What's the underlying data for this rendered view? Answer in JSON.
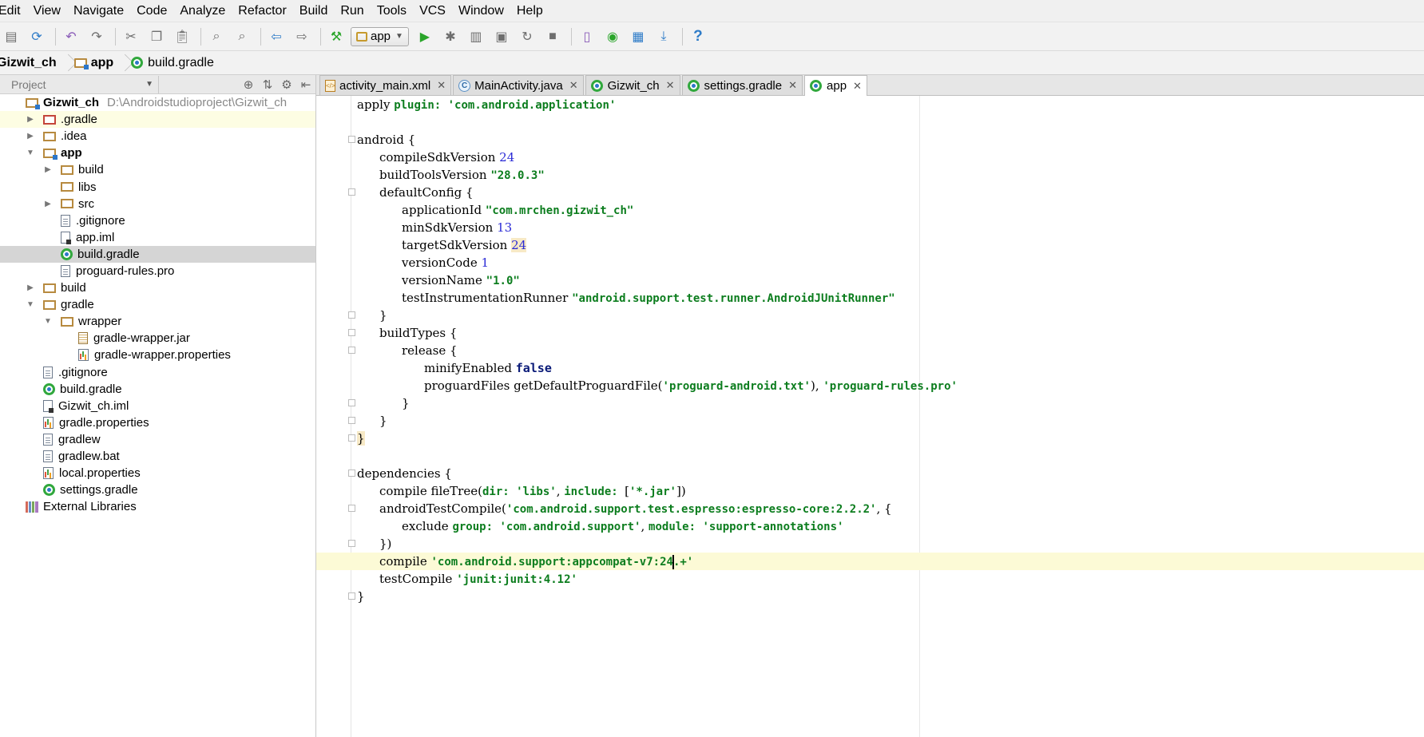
{
  "menubar": {
    "items": [
      "Edit",
      "View",
      "Navigate",
      "Code",
      "Analyze",
      "Refactor",
      "Build",
      "Run",
      "Tools",
      "VCS",
      "Window",
      "Help"
    ]
  },
  "toolbar": {
    "run_config": "app",
    "icons": [
      "save-all-icon",
      "sync-icon",
      "undo-icon",
      "redo-icon",
      "cut-icon",
      "copy-icon",
      "paste-icon",
      "find-icon",
      "replace-icon",
      "back-icon",
      "forward-icon",
      "make-project-icon",
      "run-icon",
      "debug-icon",
      "coverage-icon",
      "attach-debugger-icon",
      "apply-changes-icon",
      "stop-icon",
      "avd-manager-icon",
      "sync-gradle-icon",
      "project-structure-icon",
      "sdk-manager-icon",
      "help-icon"
    ]
  },
  "breadcrumb": {
    "items": [
      "Gizwit_ch",
      "app",
      "build.gradle"
    ]
  },
  "project_panel": {
    "view_label": "Project",
    "tree": [
      {
        "label": "Gizwit_ch",
        "path": "D:\\Androidstudioproject\\Gizwit_ch",
        "depth": 0,
        "icon": "module-folder-icon",
        "arrow": "",
        "bold": true
      },
      {
        "label": ".gradle",
        "depth": 1,
        "icon": "excluded-folder-icon",
        "arrow": "▶",
        "highlight": true
      },
      {
        "label": ".idea",
        "depth": 1,
        "icon": "folder-icon",
        "arrow": "▶"
      },
      {
        "label": "app",
        "depth": 1,
        "icon": "module-folder-icon",
        "arrow": "▼",
        "bold": true
      },
      {
        "label": "build",
        "depth": 2,
        "icon": "folder-icon",
        "arrow": "▶"
      },
      {
        "label": "libs",
        "depth": 2,
        "icon": "folder-icon",
        "arrow": ""
      },
      {
        "label": "src",
        "depth": 2,
        "icon": "folder-icon",
        "arrow": "▶"
      },
      {
        "label": ".gitignore",
        "depth": 2,
        "icon": "file-icon",
        "arrow": ""
      },
      {
        "label": "app.iml",
        "depth": 2,
        "icon": "iml-file-icon",
        "arrow": ""
      },
      {
        "label": "build.gradle",
        "depth": 2,
        "icon": "gradle-icon",
        "arrow": "",
        "selected": true
      },
      {
        "label": "proguard-rules.pro",
        "depth": 2,
        "icon": "file-icon",
        "arrow": ""
      },
      {
        "label": "build",
        "depth": 1,
        "icon": "folder-icon",
        "arrow": "▶"
      },
      {
        "label": "gradle",
        "depth": 1,
        "icon": "folder-icon",
        "arrow": "▼"
      },
      {
        "label": "wrapper",
        "depth": 2,
        "icon": "folder-icon",
        "arrow": "▼"
      },
      {
        "label": "gradle-wrapper.jar",
        "depth": 3,
        "icon": "jar-icon",
        "arrow": ""
      },
      {
        "label": "gradle-wrapper.properties",
        "depth": 3,
        "icon": "properties-icon",
        "arrow": ""
      },
      {
        "label": ".gitignore",
        "depth": 1,
        "icon": "file-icon",
        "arrow": ""
      },
      {
        "label": "build.gradle",
        "depth": 1,
        "icon": "gradle-icon",
        "arrow": ""
      },
      {
        "label": "Gizwit_ch.iml",
        "depth": 1,
        "icon": "iml-file-icon",
        "arrow": ""
      },
      {
        "label": "gradle.properties",
        "depth": 1,
        "icon": "properties-icon",
        "arrow": ""
      },
      {
        "label": "gradlew",
        "depth": 1,
        "icon": "file-icon",
        "arrow": ""
      },
      {
        "label": "gradlew.bat",
        "depth": 1,
        "icon": "file-icon",
        "arrow": ""
      },
      {
        "label": "local.properties",
        "depth": 1,
        "icon": "properties-icon",
        "arrow": ""
      },
      {
        "label": "settings.gradle",
        "depth": 1,
        "icon": "gradle-icon",
        "arrow": ""
      },
      {
        "label": "External Libraries",
        "depth": 0,
        "icon": "libraries-icon",
        "arrow": ""
      }
    ]
  },
  "tabs": [
    {
      "label": "activity_main.xml",
      "icon": "xml-icon",
      "active": false
    },
    {
      "label": "MainActivity.java",
      "icon": "class-icon",
      "active": false
    },
    {
      "label": "Gizwit_ch",
      "icon": "gradle-icon",
      "active": false
    },
    {
      "label": "settings.gradle",
      "icon": "gradle-icon",
      "active": false
    },
    {
      "label": "app",
      "icon": "gradle-icon",
      "active": true
    }
  ],
  "editor": {
    "lines": [
      {
        "indent": 0,
        "tokens": [
          [
            "t",
            "apply "
          ],
          [
            "named",
            "plugin: "
          ],
          [
            "str",
            "'com.android.application'"
          ]
        ]
      },
      {
        "indent": 0,
        "tokens": []
      },
      {
        "indent": 0,
        "fold": true,
        "tokens": [
          [
            "t",
            "android {"
          ]
        ]
      },
      {
        "indent": 1,
        "tokens": [
          [
            "t",
            "compileSdkVersion "
          ],
          [
            "num",
            "24"
          ]
        ]
      },
      {
        "indent": 1,
        "tokens": [
          [
            "t",
            "buildToolsVersion "
          ],
          [
            "str",
            "\"28.0.3\""
          ]
        ]
      },
      {
        "indent": 1,
        "fold": true,
        "tokens": [
          [
            "t",
            "defaultConfig {"
          ]
        ]
      },
      {
        "indent": 2,
        "tokens": [
          [
            "t",
            "applicationId "
          ],
          [
            "str",
            "\"com.mrchen.gizwit_ch\""
          ]
        ]
      },
      {
        "indent": 2,
        "tokens": [
          [
            "t",
            "minSdkVersion "
          ],
          [
            "num",
            "13"
          ]
        ]
      },
      {
        "indent": 2,
        "tokens": [
          [
            "t",
            "targetSdkVersion "
          ],
          [
            "numhl",
            "24"
          ]
        ]
      },
      {
        "indent": 2,
        "tokens": [
          [
            "t",
            "versionCode "
          ],
          [
            "num",
            "1"
          ]
        ]
      },
      {
        "indent": 2,
        "tokens": [
          [
            "t",
            "versionName "
          ],
          [
            "str",
            "\"1.0\""
          ]
        ]
      },
      {
        "indent": 2,
        "tokens": [
          [
            "t",
            "testInstrumentationRunner "
          ],
          [
            "str",
            "\"android.support.test.runner.AndroidJUnitRunner\""
          ]
        ]
      },
      {
        "indent": 1,
        "fold": true,
        "tokens": [
          [
            "t",
            "}"
          ]
        ]
      },
      {
        "indent": 1,
        "fold": true,
        "tokens": [
          [
            "t",
            "buildTypes {"
          ]
        ]
      },
      {
        "indent": 2,
        "fold": true,
        "tokens": [
          [
            "t",
            "release {"
          ]
        ]
      },
      {
        "indent": 3,
        "tokens": [
          [
            "t",
            "minifyEnabled "
          ],
          [
            "kw",
            "false"
          ]
        ]
      },
      {
        "indent": 3,
        "tokens": [
          [
            "t",
            "proguardFiles getDefaultProguardFile("
          ],
          [
            "str",
            "'proguard-android.txt'"
          ],
          [
            "t",
            "), "
          ],
          [
            "str",
            "'proguard-rules.pro'"
          ]
        ]
      },
      {
        "indent": 2,
        "fold": true,
        "tokens": [
          [
            "t",
            "}"
          ]
        ]
      },
      {
        "indent": 1,
        "fold": true,
        "tokens": [
          [
            "t",
            "}"
          ]
        ]
      },
      {
        "indent": 0,
        "fold": true,
        "tokens": [
          [
            "brace",
            "}"
          ]
        ]
      },
      {
        "indent": 0,
        "tokens": []
      },
      {
        "indent": 0,
        "fold": true,
        "tokens": [
          [
            "t",
            "dependencies {"
          ]
        ]
      },
      {
        "indent": 1,
        "tokens": [
          [
            "t",
            "compile fileTree("
          ],
          [
            "named",
            "dir: "
          ],
          [
            "str",
            "'libs'"
          ],
          [
            "t",
            ", "
          ],
          [
            "named",
            "include: "
          ],
          [
            "t",
            "["
          ],
          [
            "str",
            "'*.jar'"
          ],
          [
            "t",
            "])"
          ]
        ]
      },
      {
        "indent": 1,
        "fold": true,
        "tokens": [
          [
            "t",
            "androidTestCompile("
          ],
          [
            "str",
            "'com.android.support.test.espresso:espresso-core:2.2.2'"
          ],
          [
            "t",
            ", {"
          ]
        ]
      },
      {
        "indent": 2,
        "tokens": [
          [
            "t",
            "exclude "
          ],
          [
            "named",
            "group: "
          ],
          [
            "str",
            "'com.android.support'"
          ],
          [
            "t",
            ", "
          ],
          [
            "named",
            "module: "
          ],
          [
            "str",
            "'support-annotations'"
          ]
        ]
      },
      {
        "indent": 1,
        "fold": true,
        "tokens": [
          [
            "t",
            "})"
          ]
        ]
      },
      {
        "indent": 1,
        "current": true,
        "tokens": [
          [
            "t",
            "compile "
          ],
          [
            "str",
            "'com.android.support:appcompat-v7:24"
          ],
          [
            "caret",
            ""
          ],
          [
            "str",
            ".+'"
          ]
        ]
      },
      {
        "indent": 1,
        "tokens": [
          [
            "t",
            "testCompile "
          ],
          [
            "str",
            "'junit:junit:4.12'"
          ]
        ]
      },
      {
        "indent": 0,
        "fold": true,
        "tokens": [
          [
            "t",
            "}"
          ]
        ]
      }
    ]
  }
}
